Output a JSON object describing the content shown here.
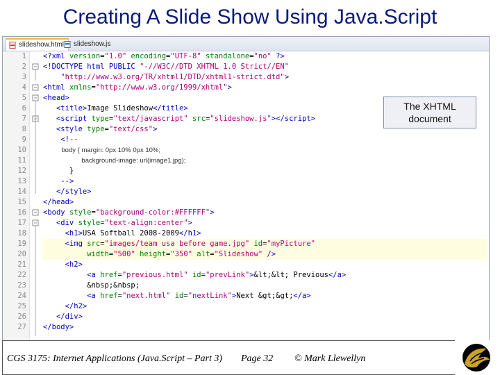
{
  "slide": {
    "title": "Creating A Slide Show Using Java.Script"
  },
  "tabs": [
    {
      "label": "slideshow.html",
      "active": true,
      "icon": "html-file-icon"
    },
    {
      "label": "slideshow.js",
      "active": false,
      "icon": "js-file-icon"
    }
  ],
  "code": {
    "lines": [
      "1",
      "2",
      "3",
      "4",
      "5",
      "6",
      "7",
      "8",
      "9",
      "10",
      "11",
      "12",
      "13",
      "14",
      "15",
      "16",
      "17",
      "18",
      "19",
      "20",
      "21",
      "22",
      "23",
      "24",
      "25",
      "26",
      "27"
    ]
  },
  "callout": {
    "line1": "The XHTML",
    "line2": "document"
  },
  "footer": {
    "course": "CGS 3175: Internet Applications (Java.Script – Part 3)",
    "page": "Page 32",
    "author": "© Mark Llewellyn"
  },
  "colors": {
    "title": "#0b1a7a",
    "tag": "#0000c8",
    "attr": "#008000",
    "value": "#b0007a",
    "highlight": "#fffde0",
    "tab_accent": "#f3b23a"
  }
}
